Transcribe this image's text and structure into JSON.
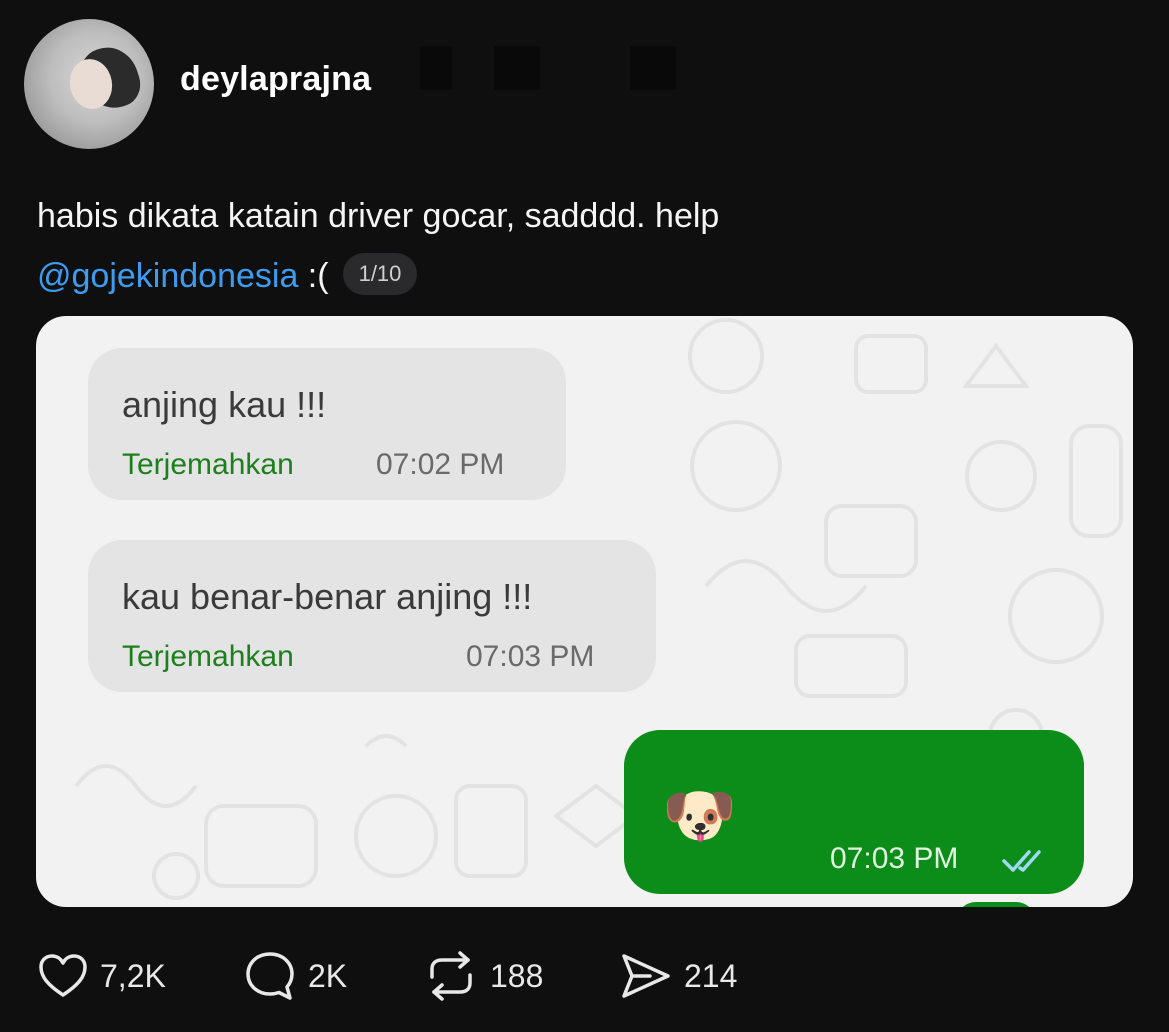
{
  "post": {
    "username": "deylaprajna",
    "caption_text": "habis dikata katain driver gocar, sadddd. help",
    "mention": "@gojekindonesia",
    "caption_suffix": " :(",
    "page_indicator": "1/10"
  },
  "chat": {
    "messages": [
      {
        "text": "anjing kau !!!",
        "translate_label": "Terjemahkan",
        "time": "07:02 PM"
      },
      {
        "text": "kau benar-benar anjing !!!",
        "translate_label": "Terjemahkan",
        "time": "07:03 PM"
      }
    ],
    "reply": {
      "emoji": "🐶",
      "time": "07:03 PM",
      "status_icon": "double-check-icon"
    },
    "colors": {
      "incoming_bubble": "#e4e4e4",
      "outgoing_bubble": "#0c8d19",
      "translate_link": "#1d7f1d"
    }
  },
  "actions": {
    "likes": "7,2K",
    "comments": "2K",
    "reposts": "188",
    "shares": "214"
  },
  "colors": {
    "background": "#0f0f10",
    "mention": "#3d9cf0"
  }
}
